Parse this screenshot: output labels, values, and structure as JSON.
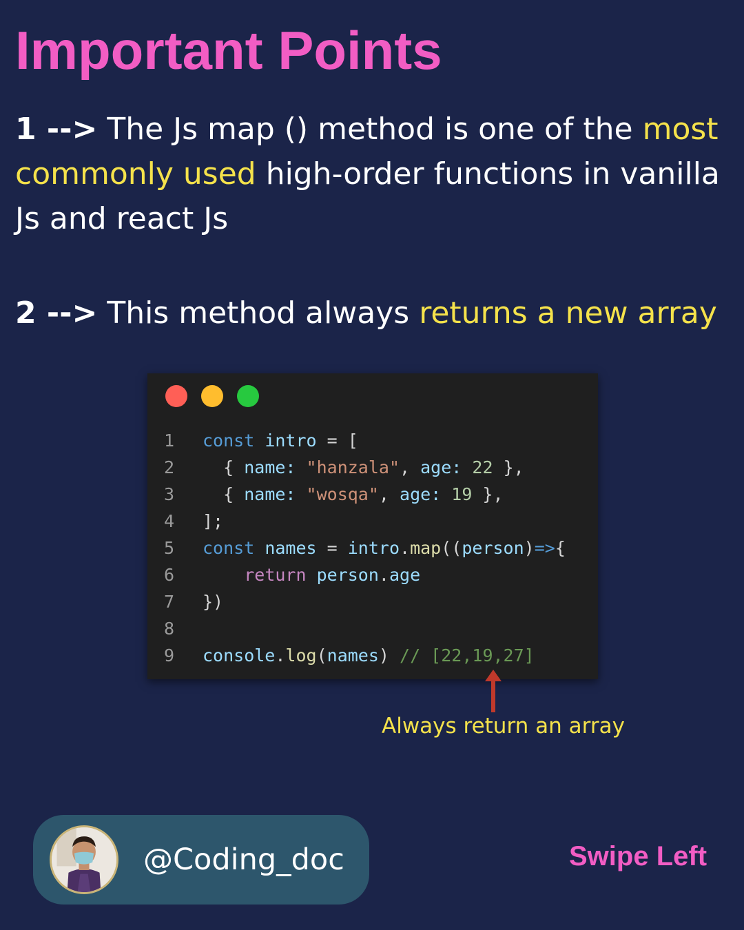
{
  "title": "Important Points",
  "point1": {
    "number": "1 -->",
    "text_a": " The Js map () method is one of the ",
    "highlight": "most commonly used",
    "text_b": " high-order functions in vanilla Js and react Js"
  },
  "point2": {
    "number": "2 -->",
    "text_a": " This method always ",
    "highlight": "returns a new array"
  },
  "code": {
    "line_numbers": [
      "1",
      "2",
      "3",
      "4",
      "5",
      "6",
      "7",
      "8",
      "9"
    ],
    "l1": {
      "kw": "const",
      "sp1": " ",
      "var": "intro",
      "rest": " = ["
    },
    "l2": {
      "a": "  { ",
      "k1": "name:",
      "sp1": " ",
      "s1": "\"hanzala\"",
      "c1": ", ",
      "k2": "age:",
      "sp2": " ",
      "n1": "22",
      "end": " },"
    },
    "l3": {
      "a": "  { ",
      "k1": "name:",
      "sp1": " ",
      "s1": "\"wosqa\"",
      "c1": ", ",
      "k2": "age:",
      "sp2": " ",
      "n1": "19",
      "end": " },"
    },
    "l4": {
      "rest": "];"
    },
    "l5": {
      "kw": "const",
      "sp1": " ",
      "v1": "names",
      "eq": " = ",
      "v2": "intro",
      "dot": ".",
      "fn": "map",
      "p1": "((",
      "v3": "person",
      "p2": ")",
      "arrow": "=>",
      "brace": "{"
    },
    "l6": {
      "indent": "    ",
      "ret": "return",
      "sp1": " ",
      "v1": "person",
      "dot": ".",
      "v2": "age"
    },
    "l7": {
      "rest": "})"
    },
    "l9": {
      "v1": "console",
      "dot": ".",
      "fn": "log",
      "p1": "(",
      "v2": "names",
      "p2": ")",
      "sp": " ",
      "cmt": "// [22,19,27]"
    }
  },
  "annotation": "Always return an array",
  "handle": "@Coding_doc",
  "swipe": "Swipe Left",
  "colors": {
    "background": "#1b2449",
    "title": "#f25dc4",
    "highlight": "#f5e24b",
    "arrow": "#c0392b",
    "pill": "#2d566c"
  }
}
